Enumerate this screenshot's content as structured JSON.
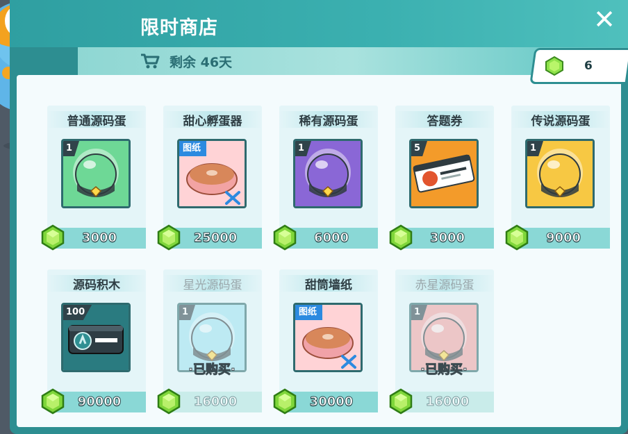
{
  "title": "限时商店",
  "remaining": "剩余 46天",
  "currency": {
    "icon": "green-gem-icon",
    "value": "6"
  },
  "items": [
    {
      "name": "普通源码蛋",
      "count": "1",
      "price": "3000",
      "kind": "egg",
      "color": "#6ed896",
      "bought": false
    },
    {
      "name": "甜心孵蛋器",
      "tag": "图纸",
      "price": "25000",
      "kind": "blueprint",
      "color": "#f2a3a3",
      "bought": false
    },
    {
      "name": "稀有源码蛋",
      "count": "1",
      "price": "6000",
      "kind": "egg",
      "color": "#8a67d6",
      "bought": false
    },
    {
      "name": "答题券",
      "count": "5",
      "price": "3000",
      "kind": "ticket",
      "color": "#f39b2a",
      "bought": false
    },
    {
      "name": "传说源码蛋",
      "count": "1",
      "price": "9000",
      "kind": "egg",
      "color": "#f7c843",
      "bought": false
    },
    {
      "name": "源码积木",
      "count": "100",
      "price": "90000",
      "kind": "block",
      "color": "#2a7b80",
      "bought": false
    },
    {
      "name": "星光源码蛋",
      "count": "1",
      "price": "16000",
      "kind": "egg",
      "color": "#9fe2f0",
      "bought": true,
      "bought_label": "·已购买·"
    },
    {
      "name": "甜筒墙纸",
      "tag": "图纸",
      "price": "30000",
      "kind": "blueprint",
      "color": "#f0a2a8",
      "bought": false
    },
    {
      "name": "赤星源码蛋",
      "count": "1",
      "price": "16000",
      "kind": "egg",
      "color": "#f3a0a0",
      "bought": true,
      "bought_label": "·已购买·"
    }
  ]
}
